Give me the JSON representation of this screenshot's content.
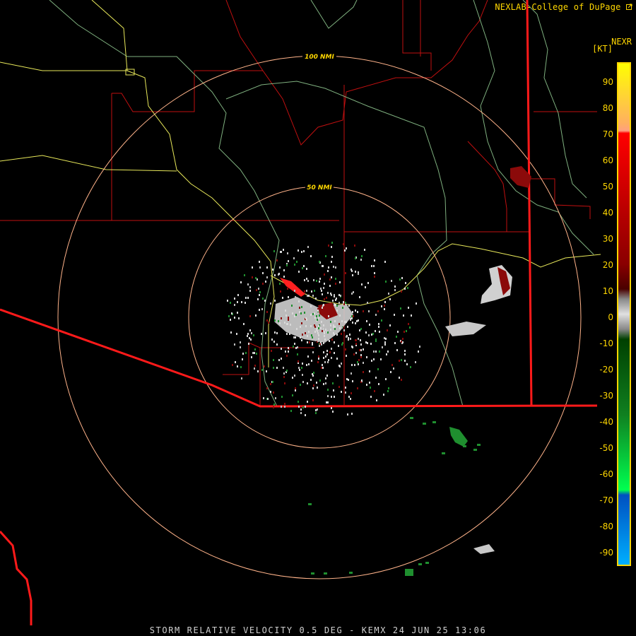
{
  "header": {
    "credit": "NEXLAB-College of DuPage",
    "credit_icon": "external-link-icon",
    "product": "NEXR",
    "unit": "[KT]"
  },
  "rings": {
    "inner_label": "50 NMI",
    "outer_label": "100 NMI"
  },
  "legend": {
    "ticks": [
      "90",
      "80",
      "70",
      "60",
      "50",
      "40",
      "30",
      "20",
      "10",
      "0",
      "-10",
      "-20",
      "-30",
      "-40",
      "-50",
      "-60",
      "-70",
      "-80",
      "-90"
    ]
  },
  "footer": {
    "caption": "STORM RELATIVE VELOCITY 0.5 DEG - KEMX 24 JUN 25 13:06"
  },
  "colors": {
    "state_border": "#ff1a1a",
    "county_border": "#c01010",
    "highway": "#e8e85a",
    "river": "#7fb07f",
    "range_ring": "#ffb38a",
    "inbound": "#1f8f2f",
    "outbound": "#8b0a0a",
    "near_zero": "#d0d0d0"
  }
}
